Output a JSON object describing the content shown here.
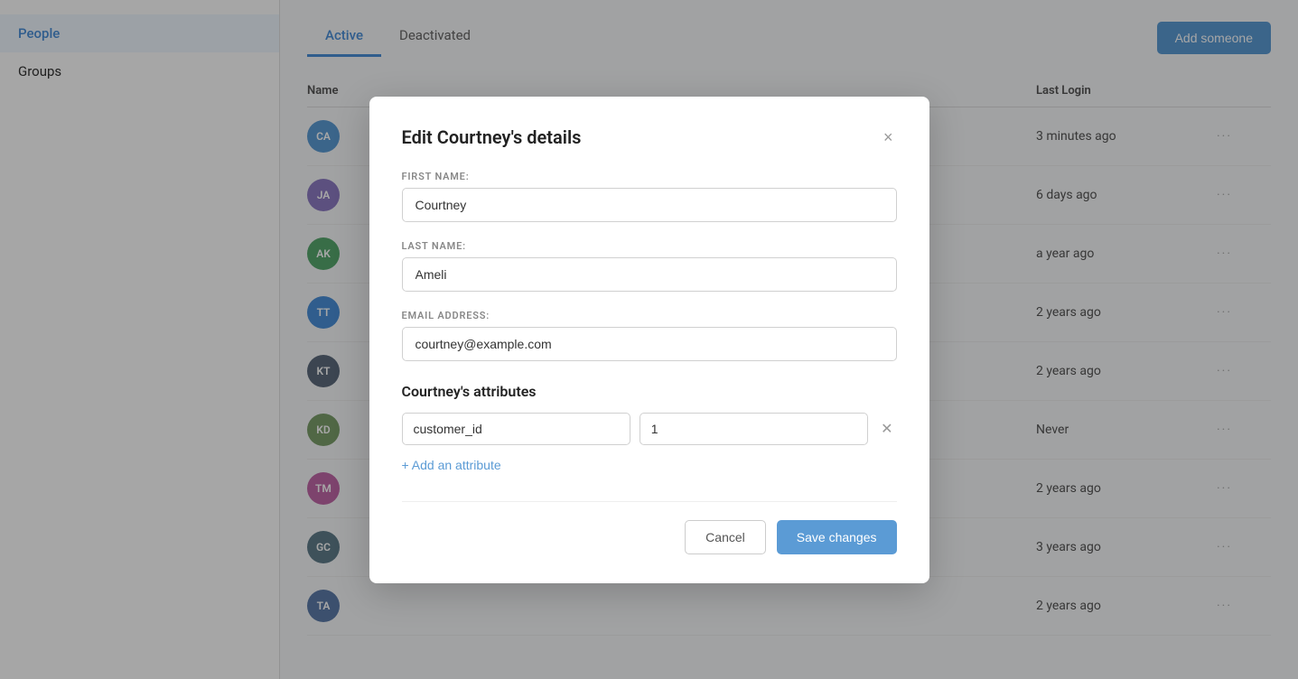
{
  "sidebar": {
    "items": [
      {
        "id": "people",
        "label": "People",
        "active": true
      },
      {
        "id": "groups",
        "label": "Groups",
        "active": false
      }
    ]
  },
  "header": {
    "tabs": [
      {
        "id": "active",
        "label": "Active",
        "active": true
      },
      {
        "id": "deactivated",
        "label": "Deactivated",
        "active": false
      }
    ],
    "add_button_label": "Add someone"
  },
  "table": {
    "columns": {
      "name": "Name",
      "last_login": "Last Login"
    },
    "rows": [
      {
        "initials": "CA",
        "color": "av-teal",
        "last_login": "3 minutes ago"
      },
      {
        "initials": "JA",
        "color": "av-purple",
        "last_login": "6 days ago"
      },
      {
        "initials": "AK",
        "color": "av-green",
        "last_login": "a year ago"
      },
      {
        "initials": "TT",
        "color": "av-blue",
        "last_login": "2 years ago"
      },
      {
        "initials": "KT",
        "color": "av-dark",
        "last_login": "2 years ago"
      },
      {
        "initials": "KD",
        "color": "av-olive",
        "last_login": "Never"
      },
      {
        "initials": "TM",
        "color": "av-pink",
        "last_login": "2 years ago"
      },
      {
        "initials": "GC",
        "color": "av-slate",
        "last_login": "3 years ago"
      },
      {
        "initials": "TA",
        "color": "av-indigo",
        "last_login": "2 years ago"
      }
    ]
  },
  "modal": {
    "title": "Edit Courtney's details",
    "close_label": "×",
    "first_name_label": "FIRST NAME:",
    "first_name_value": "Courtney",
    "last_name_label": "LAST NAME:",
    "last_name_value": "Ameli",
    "email_label": "EMAIL ADDRESS:",
    "email_value": "courtney@example.com",
    "attributes_title": "Courtney's attributes",
    "attribute_key": "customer_id",
    "attribute_value": "1",
    "add_attribute_label": "+ Add an attribute",
    "cancel_label": "Cancel",
    "save_label": "Save changes"
  }
}
